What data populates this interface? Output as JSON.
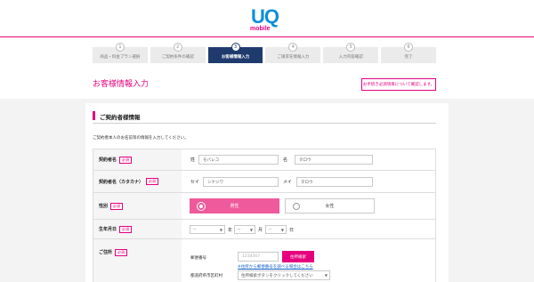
{
  "logo": {
    "mark": "UQ",
    "sub": "mobile"
  },
  "steps": [
    {
      "num": "1",
      "label": "商品・料金プラン選択",
      "active": false
    },
    {
      "num": "2",
      "label": "ご契約条件の確認",
      "active": false
    },
    {
      "num": "3",
      "label": "お客様情報入力",
      "active": true
    },
    {
      "num": "4",
      "label": "ご請求先情報入力",
      "active": false
    },
    {
      "num": "5",
      "label": "入力内容確認",
      "active": false
    },
    {
      "num": "6",
      "label": "完了",
      "active": false
    }
  ],
  "page": {
    "title": "お客様情報入力",
    "required_button": "お手続き必須項目について確認します。"
  },
  "section": {
    "title": "ご契約者様情報",
    "note": "ご契約者本人のお名前等の情報を入力してください。"
  },
  "badge_required": "必須",
  "form": {
    "name": {
      "label": "契約者名",
      "last_prefix": "姓",
      "last_value": "モバレコ",
      "first_prefix": "名",
      "first_value": "タロウ"
    },
    "kana": {
      "label": "契約者名（カタカナ）",
      "last_prefix": "セイ",
      "last_value": "シナジワ",
      "first_prefix": "メイ",
      "first_value": "タロウ"
    },
    "gender": {
      "label": "性別",
      "male": "男性",
      "female": "女性"
    },
    "birth": {
      "label": "生年月日",
      "year_value": "--",
      "year_unit": "年",
      "month_value": "--",
      "month_unit": "月",
      "day_value": "--",
      "day_unit": "日"
    },
    "address": {
      "label": "ご住所",
      "zip_label": "郵便番号",
      "zip_placeholder": "1234567",
      "zip_search_button": "住所検索",
      "zip_link": "※住所から郵便番号を調べる場合はこちら",
      "pref_label": "都道府県市区町村",
      "pref_value": "住所検索ボタンをクリックしてください"
    }
  },
  "colors": {
    "brand_magenta": "#e6007e",
    "logo_blue": "#0d8fd8",
    "active_step": "#1f3b6e"
  }
}
